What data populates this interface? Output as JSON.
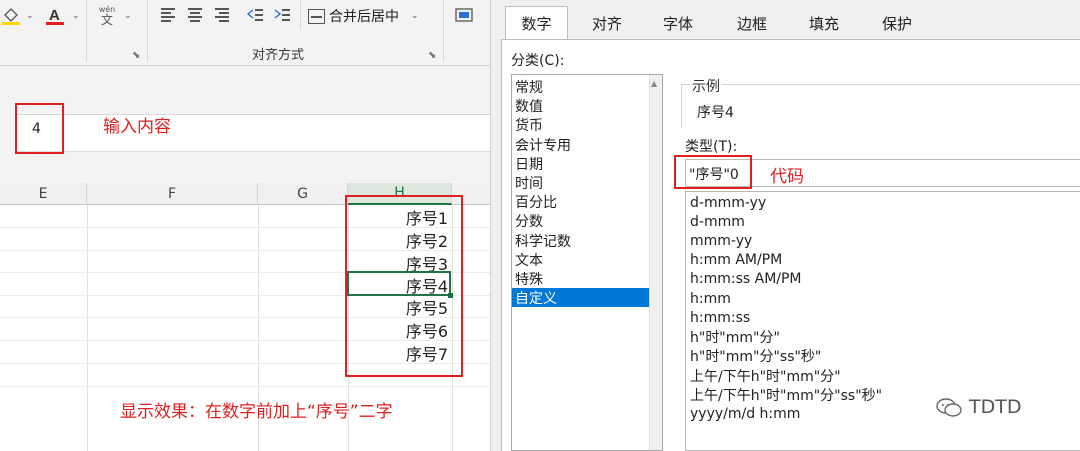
{
  "ribbon": {
    "merge_label": "合并后居中",
    "group_label": "对齐方式",
    "wen_top": "wén",
    "wen_bottom": "文"
  },
  "formula_bar": {
    "value": "4",
    "annotation": "输入内容"
  },
  "sheet": {
    "columns": [
      "E",
      "F",
      "G",
      "H"
    ],
    "selected_column": "H",
    "cells": [
      "序号1",
      "序号2",
      "序号3",
      "序号4",
      "序号5",
      "序号6",
      "序号7"
    ],
    "active_cell_value": "序号4",
    "result_annotation": "显示效果：在数字前加上“序号”二字"
  },
  "dialog": {
    "tabs": [
      "数字",
      "对齐",
      "字体",
      "边框",
      "填充",
      "保护"
    ],
    "active_tab": "数字",
    "category_label": "分类(C):",
    "categories": [
      "常规",
      "数值",
      "货币",
      "会计专用",
      "日期",
      "时间",
      "百分比",
      "分数",
      "科学记数",
      "文本",
      "特殊",
      "自定义"
    ],
    "selected_category": "自定义",
    "sample_label": "示例",
    "sample_value": "序号4",
    "type_label": "类型(T):",
    "type_value": "\"序号\"0",
    "type_annotation": "代码",
    "formats": [
      "d-mmm-yy",
      "d-mmm",
      "mmm-yy",
      "h:mm AM/PM",
      "h:mm:ss AM/PM",
      "h:mm",
      "h:mm:ss",
      "h\"时\"mm\"分\"",
      "h\"时\"mm\"分\"ss\"秒\"",
      "上午/下午h\"时\"mm\"分\"",
      "上午/下午h\"时\"mm\"分\"ss\"秒\"",
      "yyyy/m/d h:mm"
    ]
  },
  "watermark": {
    "text": "TDTD"
  },
  "colors": {
    "annotation_red": "#e02020",
    "excel_green": "#217346",
    "selection_blue": "#0078d7"
  }
}
